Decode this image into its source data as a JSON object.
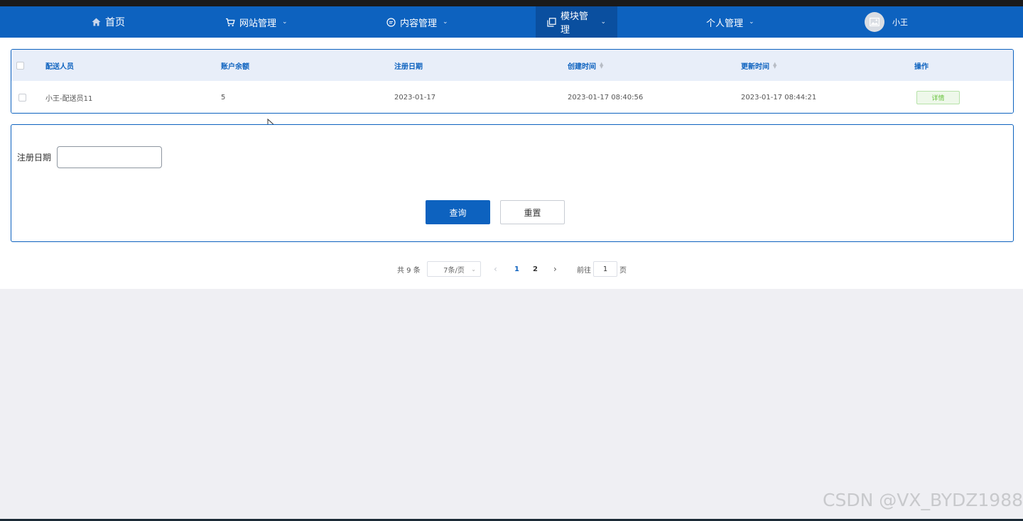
{
  "nav": {
    "home_label": "首页",
    "site_label": "网站管理",
    "content_label": "内容管理",
    "module_label": "模块管理",
    "personal_label": "个人管理",
    "user_name": "小王",
    "background_color": "#0d62bf",
    "active_background": "#0a4f9f"
  },
  "table": {
    "headers": {
      "courier": "配送人员",
      "balance": "账户余额",
      "reg_date": "注册日期",
      "created": "创建时间",
      "updated": "更新时间",
      "actions": "操作"
    },
    "rows": [
      {
        "courier": "小王-配送员11",
        "balance": "5",
        "reg_date": "2023-01-17",
        "created": "2023-01-17 08:40:56",
        "updated": "2023-01-17 08:44:21",
        "action_label": "详情"
      }
    ]
  },
  "search": {
    "reg_date_label": "注册日期",
    "reg_date_value": "",
    "query_label": "查询",
    "reset_label": "重置"
  },
  "pagination": {
    "total_text": "共 9 条",
    "page_size": "7条/页",
    "pages": [
      "1",
      "2"
    ],
    "current_page": "1",
    "goto_label": "前往",
    "goto_value": "1",
    "goto_unit": "页"
  },
  "watermark": "CSDN @VX_BYDZ1988"
}
